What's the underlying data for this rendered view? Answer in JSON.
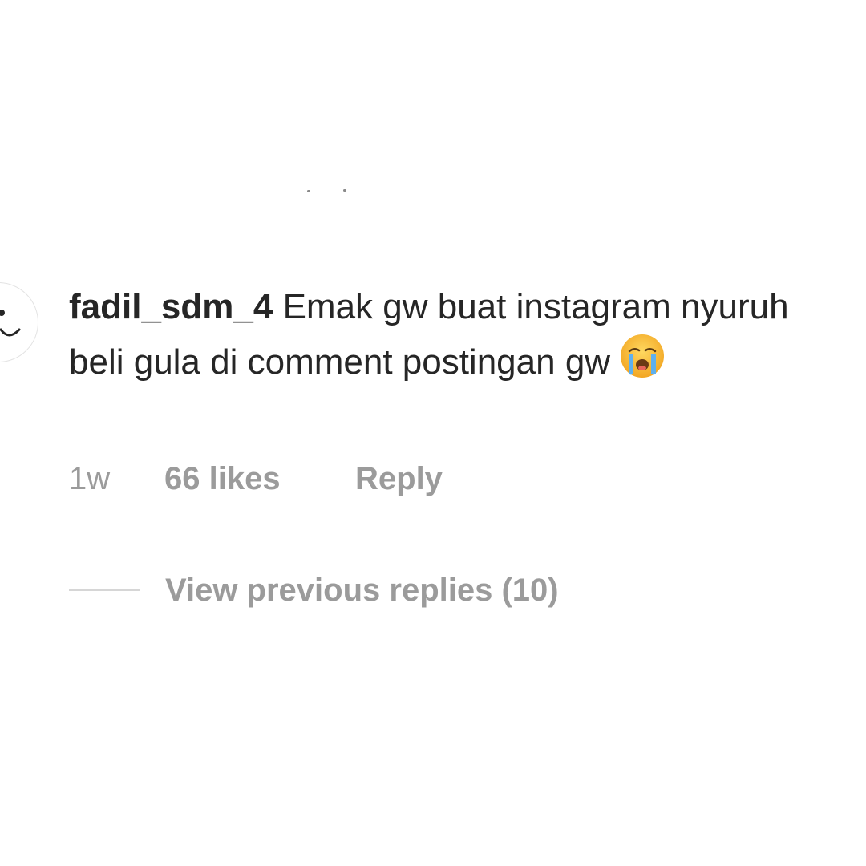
{
  "comment": {
    "username": "fadil_sdm_4",
    "text": "Emak gw buat instagram nyuruh beli gula di comment postingan gw",
    "emoji": "loudly-crying-face-icon",
    "time": "1w",
    "likes": "66 likes",
    "reply_label": "Reply"
  },
  "replies": {
    "view_previous_label": "View previous replies (10)"
  },
  "colors": {
    "text_primary": "#262626",
    "text_secondary": "#9b9b9b",
    "divider": "#d6d6d6",
    "background": "#ffffff"
  }
}
